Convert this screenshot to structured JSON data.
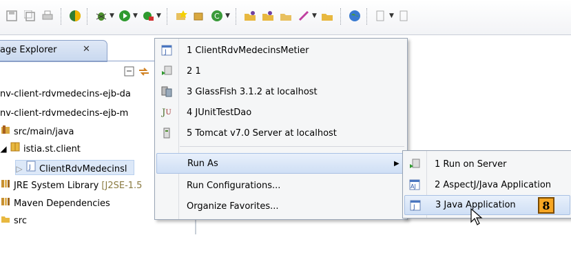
{
  "toolbar": {
    "icons": [
      "save-icon",
      "save-all-icon",
      "print-icon",
      "java-perspective-icon",
      "debug-icon",
      "run-icon",
      "external-tools-icon",
      "new-java-project-icon",
      "new-package-icon",
      "new-class-icon",
      "open-type-icon",
      "open-task-icon",
      "search-icon",
      "open-folder-icon",
      "globe-icon",
      "navigate-icon",
      "pin-icon"
    ]
  },
  "explorer": {
    "tab_title": "age Explorer",
    "close_glyph": "✕",
    "items": [
      {
        "label": "nv-client-rdvmedecins-ejb-da",
        "icon": "project-icon"
      },
      {
        "label": "nv-client-rdvmedecins-ejb-m",
        "icon": "project-icon"
      },
      {
        "label": "src/main/java",
        "icon": "source-folder-icon"
      },
      {
        "label": "istia.st.client",
        "icon": "package-icon"
      },
      {
        "label": "ClientRdvMedecinsl",
        "icon": "java-file-icon"
      },
      {
        "label": "JRE System Library",
        "suffix": "[J2SE-1.5",
        "icon": "library-icon"
      },
      {
        "label": "Maven Dependencies",
        "icon": "library-icon"
      },
      {
        "label": "src",
        "icon": "folder-icon"
      }
    ]
  },
  "menu": {
    "history": [
      {
        "label": "1 ClientRdvMedecinsMetier",
        "icon": "java-app-icon"
      },
      {
        "label": "2 1",
        "icon": "server-run-icon"
      },
      {
        "label": "3 GlassFish 3.1.2 at localhost",
        "icon": "glassfish-icon"
      },
      {
        "label": "4 JUnitTestDao",
        "icon": "junit-icon"
      },
      {
        "label": "5 Tomcat v7.0 Server at localhost",
        "icon": "tomcat-icon"
      }
    ],
    "run_as": "Run As",
    "run_configurations": "Run Configurations...",
    "organize_favorites": "Organize Favorites..."
  },
  "submenu": {
    "items": [
      {
        "label": "1 Run on Server",
        "icon": "server-run-icon"
      },
      {
        "label": "2 AspectJ/Java Application",
        "icon": "aspectj-icon"
      },
      {
        "label": "3 Java Application",
        "icon": "java-app-icon"
      }
    ]
  },
  "annotation": {
    "step_number": "8"
  },
  "colors": {
    "highlight": "#cfdff5",
    "badge": "#f6a623",
    "tab": "#c8d8ef"
  }
}
